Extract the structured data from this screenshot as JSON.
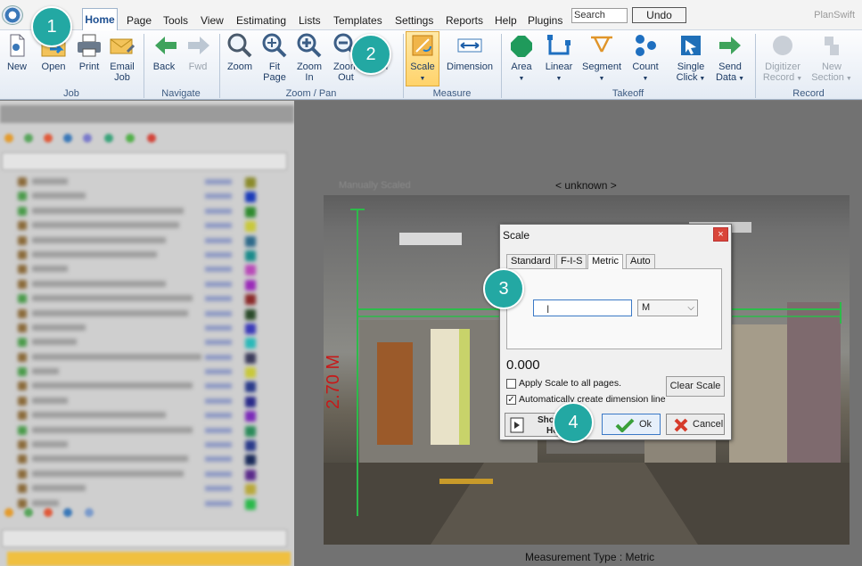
{
  "menubar": {
    "items": [
      "Home",
      "Page",
      "Tools",
      "View",
      "Estimating",
      "Lists",
      "Templates",
      "Settings",
      "Reports",
      "Help",
      "Plugins"
    ],
    "search_value": "Search",
    "undo_label": "Undo",
    "brand": "PlanSwift"
  },
  "ribbon": {
    "job": {
      "label": "Job",
      "new": "New",
      "open": "Open",
      "print": "Print",
      "email_l1": "Email",
      "email_l2": "Job"
    },
    "navigate": {
      "label": "Navigate",
      "back": "Back",
      "fwd": "Fwd"
    },
    "zoom_pan": {
      "label": "Zoom / Pan",
      "zoom": "Zoom",
      "fit_l1": "Fit",
      "fit_l2": "Page",
      "zoom_in_l1": "Zoom",
      "zoom_in_l2": "In",
      "zoom_out_l1": "Zoom",
      "zoom_out_l2": "Out",
      "pan_partial": "n"
    },
    "measure": {
      "label": "Measure",
      "scale": "Scale",
      "dimension": "Dimension"
    },
    "takeoff": {
      "label": "Takeoff",
      "area": "Area",
      "linear": "Linear",
      "segment": "Segment",
      "count": "Count",
      "single_l1": "Single",
      "single_l2": "Click",
      "send_l1": "Send",
      "send_l2": "Data"
    },
    "record": {
      "label": "Record",
      "digitizer_l1": "Digitizer",
      "digitizer_l2": "Record",
      "new_l1": "New",
      "new_l2": "Section"
    }
  },
  "main": {
    "manual_scaled": "Manually Scaled",
    "scale_status": "< unknown >",
    "dimension_text": "2.70 M",
    "measurement_type": "Measurement Type : Metric"
  },
  "dialog": {
    "title": "Scale",
    "close": "×",
    "tabs": [
      "Standard",
      "F-I-S",
      "Metric",
      "Auto"
    ],
    "scale_input_value": "",
    "unit_selected": "M",
    "scale_value": "0.000",
    "apply_all_label": "Apply Scale to all pages.",
    "apply_all_checked": false,
    "auto_dim_label": "Automatically create dimension line",
    "auto_dim_checked": true,
    "clear_scale": "Clear Scale",
    "show_l1": "Sho",
    "show_l2": "Ho",
    "ok": "Ok",
    "cancel": "Cancel"
  },
  "badges": [
    "1",
    "2",
    "3",
    "4"
  ],
  "colors": {
    "accent": "#23a8a3",
    "ribbon_text": "#1f3d66",
    "dimension": "#2dbb4a"
  }
}
